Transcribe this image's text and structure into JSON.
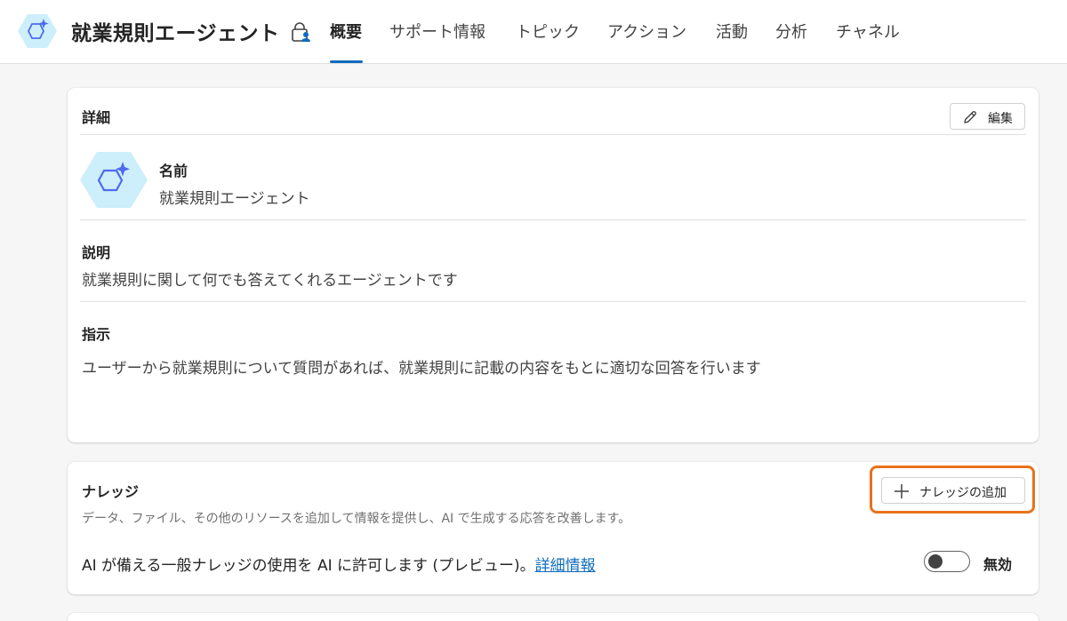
{
  "header": {
    "agent_name": "就業規則エージェント",
    "tabs": [
      {
        "label": "概要",
        "active": true
      },
      {
        "label": "サポート情報",
        "active": false
      },
      {
        "label": "トピック",
        "active": false
      },
      {
        "label": "アクション",
        "active": false
      },
      {
        "label": "活動",
        "active": false
      },
      {
        "label": "分析",
        "active": false
      },
      {
        "label": "チャネル",
        "active": false
      }
    ]
  },
  "details": {
    "heading": "詳細",
    "edit_label": "編集",
    "name_label": "名前",
    "name_value": "就業規則エージェント",
    "description_label": "説明",
    "description_value": "就業規則に関して何でも答えてくれるエージェントです",
    "instructions_label": "指示",
    "instructions_value": "ユーザーから就業規則について質問があれば、就業規則に記載の内容をもとに適切な回答を行います"
  },
  "knowledge": {
    "heading": "ナレッジ",
    "add_label": "ナレッジの追加",
    "description": "データ、ファイル、その他のリソースを追加して情報を提供し、AI で生成する応答を改善します。",
    "general_text": "AI が備える一般ナレッジの使用を AI に許可します (プレビュー)。",
    "learn_more": "詳細情報",
    "toggle_label": "無効",
    "toggle_on": false
  },
  "colors": {
    "accent": "#0f6cbd",
    "highlight": "#e9711c",
    "avatar_fill": "#cdeefb",
    "avatar_stroke": "#4f6bed"
  },
  "icons": {
    "agent": "agent-hexagon-sparkle-icon",
    "lock": "lock-person-icon",
    "edit": "pencil-icon",
    "add": "plus-icon"
  }
}
